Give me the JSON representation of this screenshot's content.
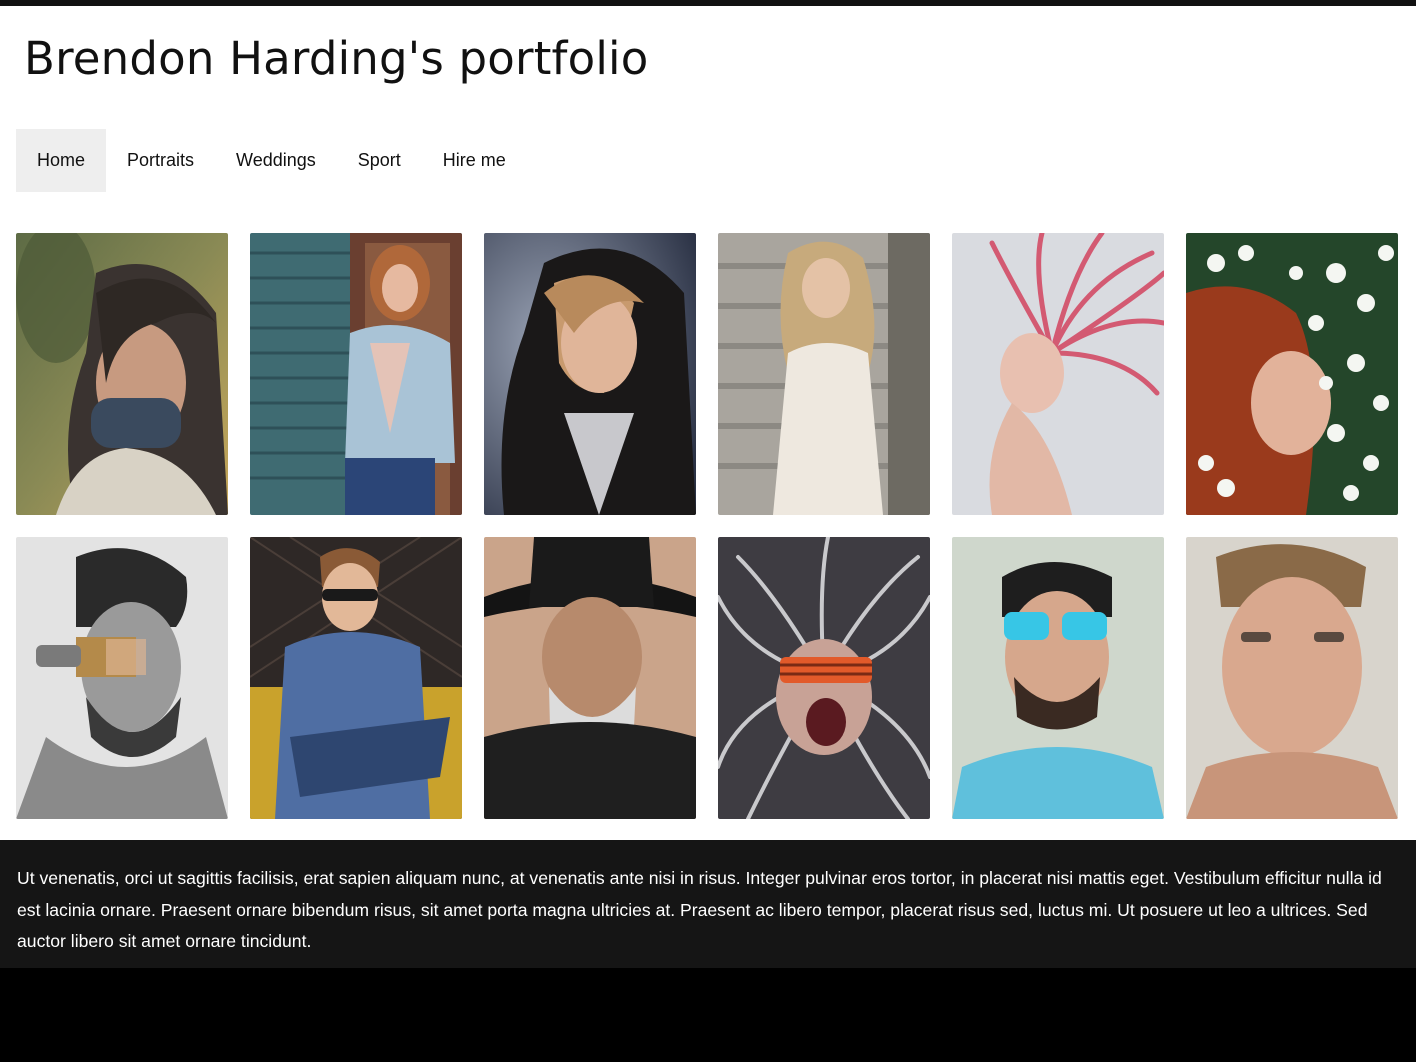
{
  "site": {
    "title": "Brendon Harding's portfolio"
  },
  "nav": {
    "items": [
      {
        "label": "Home",
        "active": true
      },
      {
        "label": "Portraits",
        "active": false
      },
      {
        "label": "Weddings",
        "active": false
      },
      {
        "label": "Sport",
        "active": false
      },
      {
        "label": "Hire me",
        "active": false
      }
    ]
  },
  "gallery": {
    "photos": [
      {
        "subject": "woman-in-scarf-profile"
      },
      {
        "subject": "woman-in-denim-jacket"
      },
      {
        "subject": "woman-in-fur-hood"
      },
      {
        "subject": "woman-in-white-dress-on-steps"
      },
      {
        "subject": "woman-with-pink-hair"
      },
      {
        "subject": "redhead-among-white-flowers"
      },
      {
        "subject": "man-with-paintbrush"
      },
      {
        "subject": "man-with-glasses-writing"
      },
      {
        "subject": "older-man-in-cowboy-hat"
      },
      {
        "subject": "man-with-shutter-shades-screaming"
      },
      {
        "subject": "man-with-blue-sunglasses"
      },
      {
        "subject": "young-man-close-up"
      }
    ]
  },
  "footer": {
    "text": "Ut venenatis, orci ut sagittis facilisis, erat sapien aliquam nunc, at venenatis ante nisi in risus. Integer pulvinar eros tortor, in placerat nisi mattis eget. Vestibulum efficitur nulla id est lacinia ornare. Praesent ornare bibendum risus, sit amet porta magna ultricies at. Praesent ac libero tempor, placerat risus sed, luctus mi. Ut posuere ut leo a ultrices. Sed auctor libero sit amet ornare tincidunt."
  },
  "colors": {
    "page_bg": "#ffffff",
    "top_bar": "#111111",
    "nav_active_bg": "#eeeeee",
    "footer_bg": "#151515",
    "outer_bg": "#000000"
  }
}
